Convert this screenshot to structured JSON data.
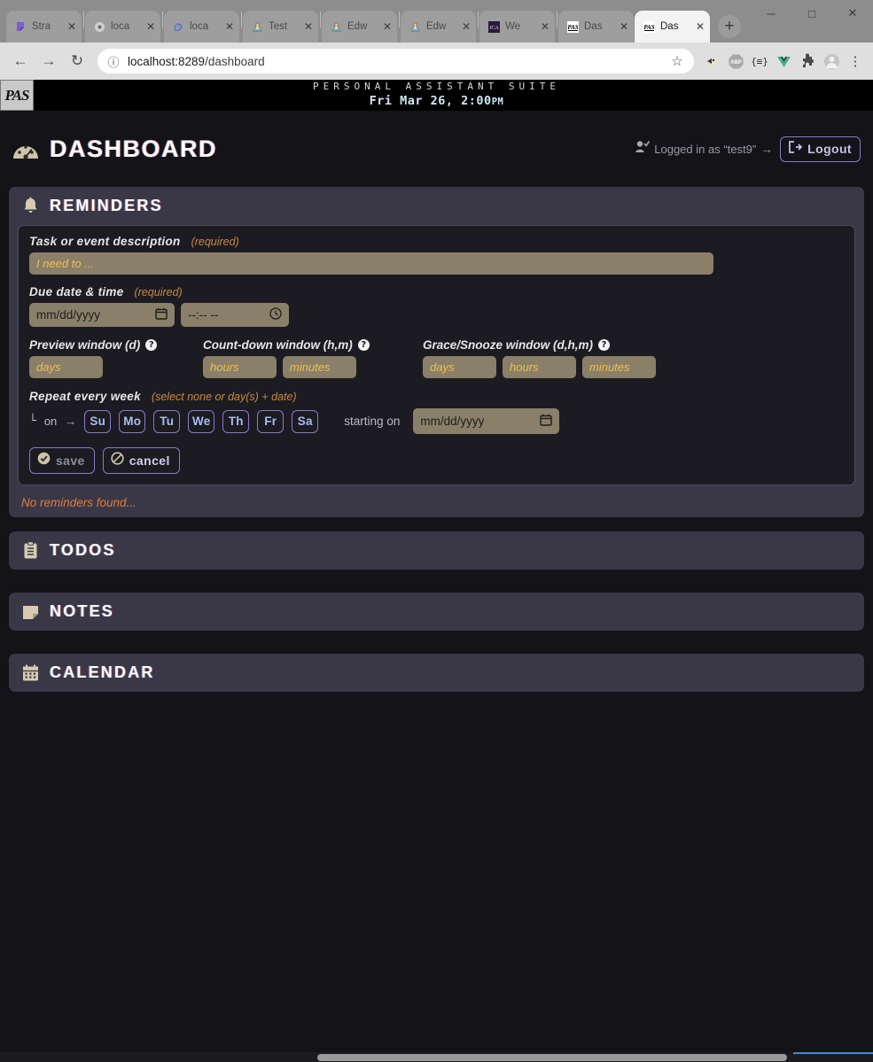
{
  "browser": {
    "tabs": [
      {
        "title": "Stra",
        "favicon": "purple-flag-icon",
        "active": false
      },
      {
        "title": "loca",
        "favicon": "gear-icon",
        "active": false
      },
      {
        "title": "loca",
        "favicon": "blue-sketch-icon",
        "active": false
      },
      {
        "title": "Test",
        "favicon": "flask-icon",
        "active": false
      },
      {
        "title": "Edw",
        "favicon": "flask-icon",
        "active": false
      },
      {
        "title": "Edw",
        "favicon": "flask-icon",
        "active": false
      },
      {
        "title": "We",
        "favicon": "jca-icon",
        "active": false
      },
      {
        "title": "Das",
        "favicon": "pas-icon",
        "active": false
      },
      {
        "title": "Das",
        "favicon": "pas-icon",
        "active": true
      }
    ],
    "tab_close_label": "✕",
    "new_tab_label": "+",
    "window_controls": [
      "─",
      "□",
      "✕"
    ],
    "nav": {
      "back": "←",
      "forward": "→",
      "reload": "↻",
      "info_icon": "ⓘ",
      "star_icon": "☆"
    },
    "url_scheme_host": "localhost:8289",
    "url_path": "/dashboard",
    "extensions": [
      {
        "name": "privacy-badger-icon",
        "glyph": "🦡"
      },
      {
        "name": "adblock-plus-icon",
        "glyph": "ABP"
      },
      {
        "name": "json-formatter-icon",
        "glyph": "{≡}"
      },
      {
        "name": "vue-devtools-icon",
        "glyph": "V"
      },
      {
        "name": "extensions-puzzle-icon",
        "glyph": "🧩"
      },
      {
        "name": "profile-avatar-icon",
        "glyph": "●"
      },
      {
        "name": "chrome-menu-icon",
        "glyph": "⋮"
      }
    ]
  },
  "app": {
    "logo_text": "PAS",
    "suite_title": "PERSONAL ASSISTANT SUITE",
    "date_main": "Fri Mar 26,  2:00",
    "date_ampm": "PM"
  },
  "header": {
    "title": "DASHBOARD",
    "logged_in_text": "Logged in as “test9”",
    "arrow": "→",
    "logout_label": "Logout"
  },
  "reminders": {
    "section_title": "REMINDERS",
    "description": {
      "label": "Task or event description",
      "required_note": "(required)",
      "placeholder": "I need to ..."
    },
    "due": {
      "label": "Due date & time",
      "required_note": "(required)",
      "date_placeholder": "mm/dd/yyyy",
      "time_placeholder": "--:-- --"
    },
    "preview_window": {
      "label": "Preview window (d)",
      "help": "?",
      "inputs": [
        {
          "placeholder": "days"
        }
      ]
    },
    "countdown_window": {
      "label": "Count-down window (h,m)",
      "help": "?",
      "inputs": [
        {
          "placeholder": "hours"
        },
        {
          "placeholder": "minutes"
        }
      ]
    },
    "grace_window": {
      "label": "Grace/Snooze window (d,h,m)",
      "help": "?",
      "inputs": [
        {
          "placeholder": "days"
        },
        {
          "placeholder": "hours"
        },
        {
          "placeholder": "minutes"
        }
      ]
    },
    "repeat": {
      "label": "Repeat every week",
      "hint": "(select none or day(s) + date)",
      "corner": "└",
      "on_label": "on",
      "arrow": "→",
      "days": [
        "Su",
        "Mo",
        "Tu",
        "We",
        "Th",
        "Fr",
        "Sa"
      ],
      "starting_label": "starting on",
      "start_placeholder": "mm/dd/yyyy"
    },
    "buttons": {
      "save": "save",
      "cancel": "cancel"
    },
    "empty_message": "No reminders found..."
  },
  "sections": [
    {
      "title": "TODOS",
      "icon": "clipboard-icon"
    },
    {
      "title": "NOTES",
      "icon": "note-icon"
    },
    {
      "title": "CALENDAR",
      "icon": "calendar-icon"
    }
  ],
  "colors": {
    "body_bg": "#141318",
    "panel_bg": "#3a3847",
    "input_bg": "#8a7f68",
    "accent_purple": "#8b79c9",
    "accent_gold": "#f0c050",
    "warn_orange": "#e07b3a"
  }
}
